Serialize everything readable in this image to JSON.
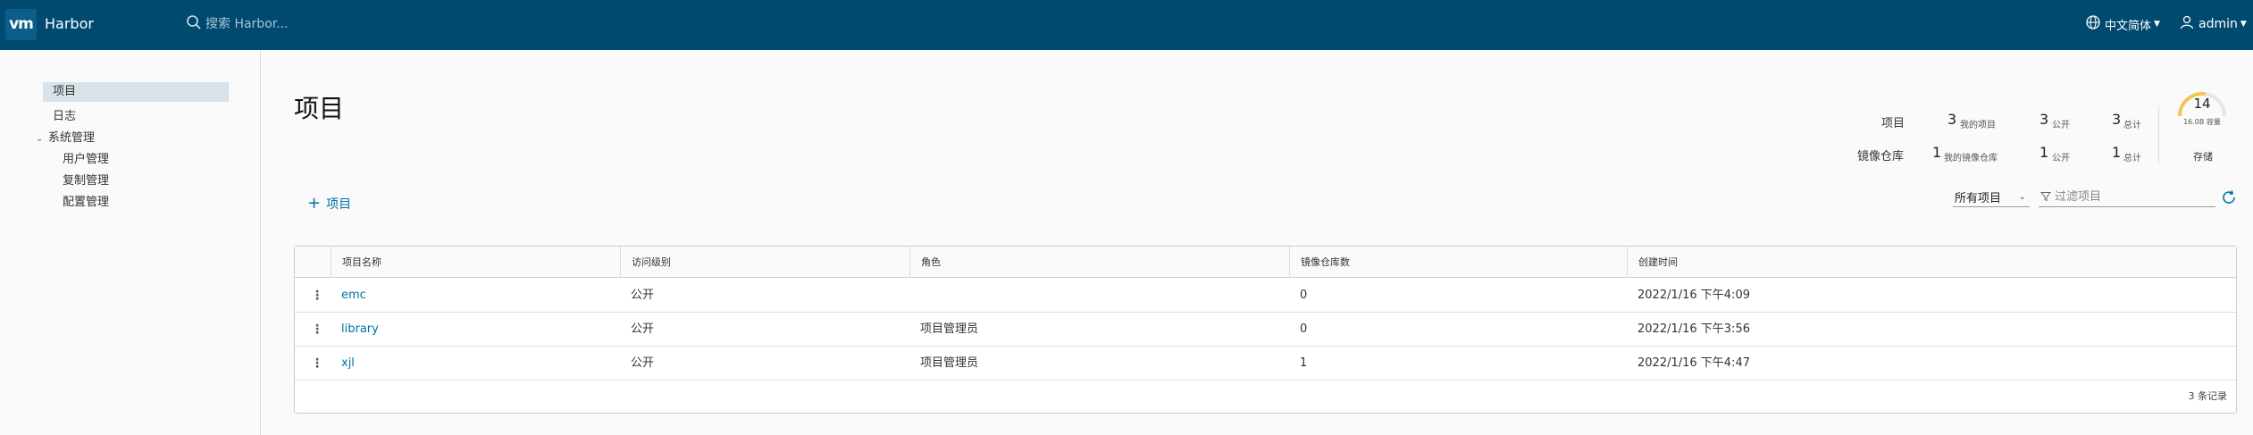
{
  "header": {
    "logo": "vm",
    "app_title": "Harbor",
    "search_placeholder": "搜索 Harbor...",
    "language": "中文简体",
    "user": "admin"
  },
  "sidebar": {
    "items": [
      {
        "label": "项目",
        "active": true
      },
      {
        "label": "日志"
      },
      {
        "label": "系统管理",
        "expanded": true,
        "children": [
          {
            "label": "用户管理"
          },
          {
            "label": "复制管理"
          },
          {
            "label": "配置管理"
          }
        ]
      }
    ]
  },
  "main": {
    "title": "项目",
    "stats": {
      "projects": {
        "label": "项目",
        "mine": "3",
        "mine_label": "我的项目",
        "public": "3",
        "public_label": "公开",
        "total": "3",
        "total_label": "总计"
      },
      "repos": {
        "label": "镜像仓库",
        "mine": "1",
        "mine_label": "我的镜像仓库",
        "public": "1",
        "public_label": "公开",
        "total": "1",
        "total_label": "总计"
      },
      "storage": {
        "value": "14",
        "sub": "16.0B 容量",
        "label": "存储",
        "fraction": 0.55
      }
    },
    "add_project_label": "项目",
    "filter": {
      "selected": "所有项目",
      "placeholder": "过滤项目"
    },
    "table": {
      "columns": [
        "项目名称",
        "访问级别",
        "角色",
        "镜像仓库数",
        "创建时间"
      ],
      "rows": [
        {
          "name": "emc",
          "access": "公开",
          "role": "",
          "repos": "0",
          "created": "2022/1/16 下午4:09"
        },
        {
          "name": "library",
          "access": "公开",
          "role": "项目管理员",
          "repos": "0",
          "created": "2022/1/16 下午3:56"
        },
        {
          "name": "xjl",
          "access": "公开",
          "role": "项目管理员",
          "repos": "1",
          "created": "2022/1/16 下午4:47"
        }
      ],
      "footer": "3 条记录"
    }
  },
  "colors": {
    "header_bg": "#004a70",
    "link": "#0072a3",
    "active_nav": "#d8e3e9",
    "gauge": "#f5c451"
  }
}
